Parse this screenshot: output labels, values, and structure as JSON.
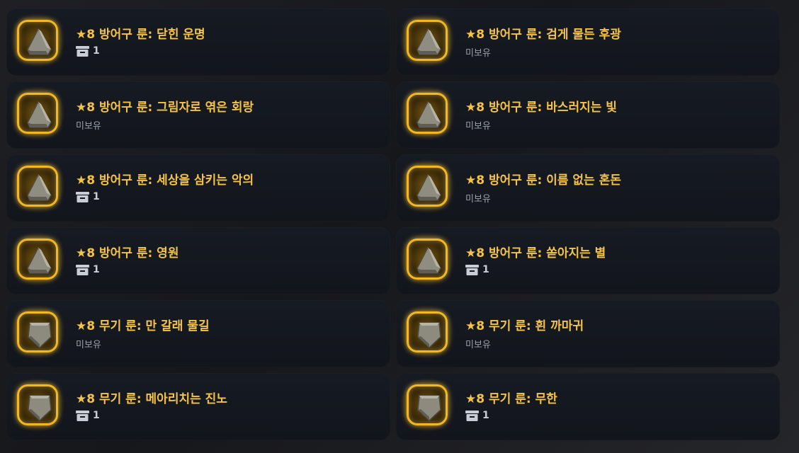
{
  "colors": {
    "title": "#f6c443",
    "frame": "#f3b820",
    "card": "#141820"
  },
  "cards": [
    {
      "title": "★8 방어구 룬: 닫힌 운명",
      "kind": "armor",
      "rune": "ᛒ",
      "owned": true,
      "count": "1",
      "status": ""
    },
    {
      "title": "★8 방어구 룬: 검게 물든 후광",
      "kind": "armor",
      "rune": "ᛜ",
      "owned": false,
      "count": "",
      "status": "미보유"
    },
    {
      "title": "★8 방어구 룬: 그림자로 엮은 회랑",
      "kind": "armor",
      "rune": "ᛉ",
      "owned": false,
      "count": "",
      "status": "미보유"
    },
    {
      "title": "★8 방어구 룬: 바스러지는 빛",
      "kind": "armor",
      "rune": "ᚢ",
      "owned": false,
      "count": "",
      "status": "미보유"
    },
    {
      "title": "★8 방어구 룬: 세상을 삼키는 악의",
      "kind": "armor",
      "rune": "ᚦ",
      "owned": true,
      "count": "1",
      "status": ""
    },
    {
      "title": "★8 방어구 룬: 이름 없는 혼돈",
      "kind": "armor",
      "rune": "ᚲ",
      "owned": false,
      "count": "",
      "status": "미보유"
    },
    {
      "title": "★8 방어구 룬: 영원",
      "kind": "armor",
      "rune": "ᚨ",
      "owned": true,
      "count": "1",
      "status": ""
    },
    {
      "title": "★8 방어구 룬: 쏟아지는 별",
      "kind": "armor",
      "rune": "ᛞ",
      "owned": true,
      "count": "1",
      "status": ""
    },
    {
      "title": "★8 무기 룬: 만 갈래 물길",
      "kind": "weapon",
      "rune": "ᚠ",
      "owned": false,
      "count": "",
      "status": "미보유"
    },
    {
      "title": "★8 무기 룬: 흰 까마귀",
      "kind": "weapon",
      "rune": "ᛈ",
      "owned": false,
      "count": "",
      "status": "미보유"
    },
    {
      "title": "★8 무기 룬: 메아리치는 진노",
      "kind": "weapon",
      "rune": "ᛇ",
      "owned": true,
      "count": "1",
      "status": ""
    },
    {
      "title": "★8 무기 룬: 무한",
      "kind": "weapon",
      "rune": "ᛞ",
      "owned": true,
      "count": "1",
      "status": ""
    }
  ]
}
